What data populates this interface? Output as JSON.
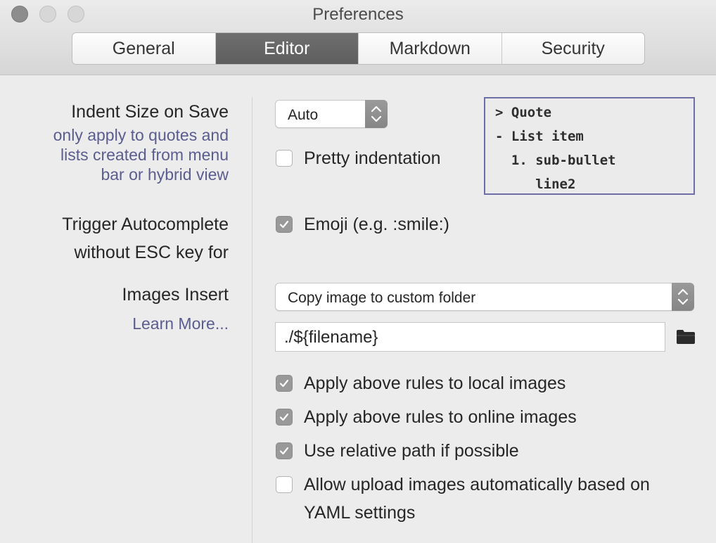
{
  "window": {
    "title": "Preferences"
  },
  "tabs": [
    {
      "label": "General",
      "active": false
    },
    {
      "label": "Editor",
      "active": true
    },
    {
      "label": "Markdown",
      "active": false
    },
    {
      "label": "Security",
      "active": false
    }
  ],
  "indent": {
    "label": "Indent Size on Save",
    "note_lines": [
      "only apply to quotes and",
      "lists created from menu",
      "bar or hybrid view"
    ],
    "select_value": "Auto",
    "pretty_indentation": {
      "label": "Pretty indentation",
      "checked": false
    },
    "preview_lines": [
      "> Quote",
      "- List item",
      "  1. sub-bullet",
      "     line2"
    ]
  },
  "autocomplete": {
    "label_lines": [
      "Trigger Autocomplete",
      "without ESC key for"
    ],
    "emoji": {
      "label": "Emoji (e.g. :smile:)",
      "checked": true
    }
  },
  "images": {
    "label": "Images Insert",
    "learn_more": "Learn More...",
    "action_value": "Copy image to custom folder",
    "path_value": "./${filename}",
    "options": [
      {
        "label": "Apply above rules to local images",
        "checked": true
      },
      {
        "label": "Apply above rules to online images",
        "checked": true
      },
      {
        "label": "Use relative path if possible",
        "checked": true
      },
      {
        "label": "Allow upload images automatically based on",
        "label2": "YAML settings",
        "checked": false
      }
    ]
  },
  "icons": {
    "folder": "folder-icon",
    "stepper": "up-down-chevron-icon",
    "checkmark": "checkmark-icon"
  },
  "colors": {
    "active_tab": "#666666",
    "note_text": "#5b5d8f",
    "preview_border": "#6d6fa6",
    "checkbox_checked": "#999999"
  }
}
